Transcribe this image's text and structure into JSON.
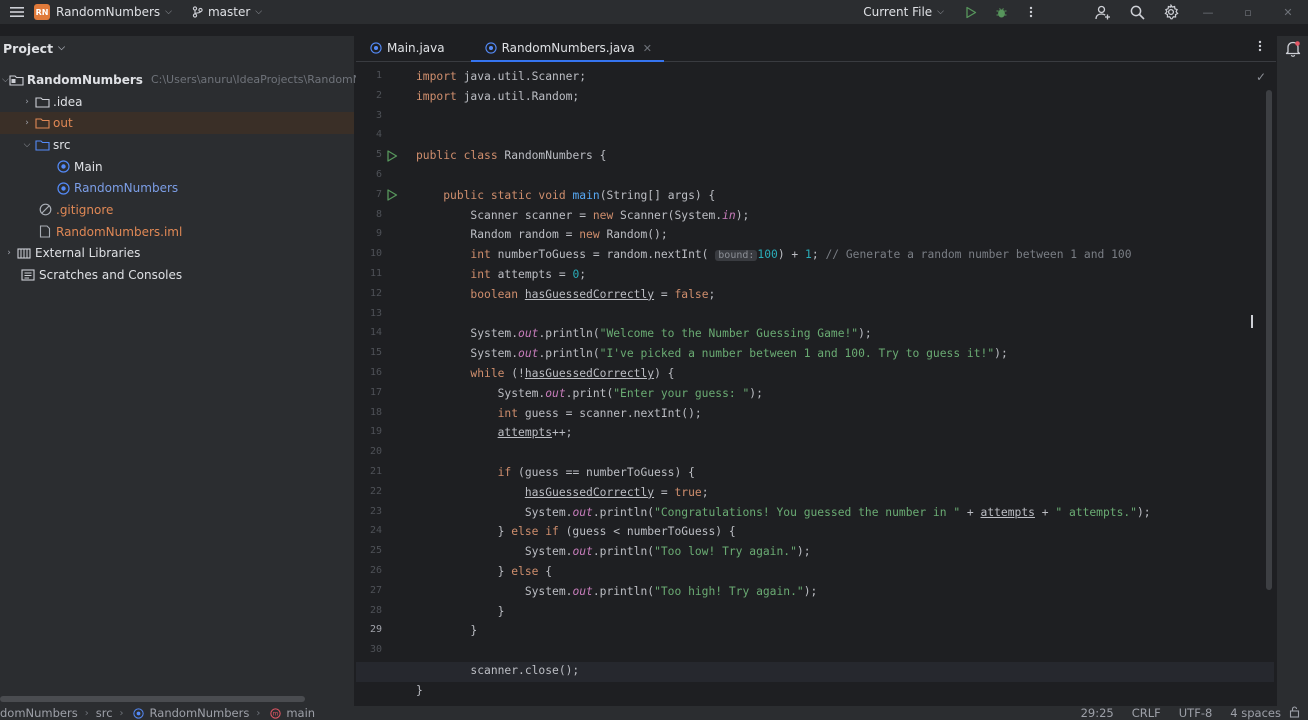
{
  "titlebar": {
    "project_badge": "RN",
    "project_name": "RandomNumbers",
    "branch": "master",
    "run_config": "Current File",
    "icons": [
      "menu-icon",
      "branch-icon",
      "run-icon",
      "debug-icon",
      "more-icon",
      "add-user-icon",
      "search-icon",
      "settings-icon"
    ]
  },
  "project_panel": {
    "title": "Project",
    "root_name": "RandomNumbers",
    "root_path": "C:\\Users\\anuru\\IdeaProjects\\RandomN",
    "idea": ".idea",
    "out": "out",
    "src": "src",
    "main": "Main",
    "random_numbers": "RandomNumbers",
    "gitignore": ".gitignore",
    "iml": "RandomNumbers.iml",
    "external_libraries": "External Libraries",
    "scratches": "Scratches and Consoles"
  },
  "tabs": [
    {
      "label": "Main.java",
      "active": false
    },
    {
      "label": "RandomNumbers.java",
      "active": true
    }
  ],
  "code": {
    "line_numbers": [
      "1",
      "2",
      "3",
      "4",
      "5",
      "6",
      "7",
      "8",
      "9",
      "10",
      "11",
      "12",
      "13",
      "14",
      "15",
      "16",
      "17",
      "18",
      "19",
      "20",
      "21",
      "22",
      "23",
      "24",
      "25",
      "26",
      "27",
      "28",
      "29",
      "30"
    ],
    "current_line": "29",
    "inlay_hint": "bound:"
  },
  "statusbar": {
    "breadcrumbs": [
      "domNumbers",
      "src",
      "RandomNumbers",
      "main"
    ],
    "position": "29:25",
    "line_separator": "CRLF",
    "encoding": "UTF-8",
    "indent": "4 spaces"
  },
  "colors": {
    "accent": "#3574f0",
    "keyword": "#cf8e6d",
    "string": "#6aab73",
    "field": "#c77dbb",
    "background": "#1e1f22",
    "panel": "#2b2d30"
  }
}
